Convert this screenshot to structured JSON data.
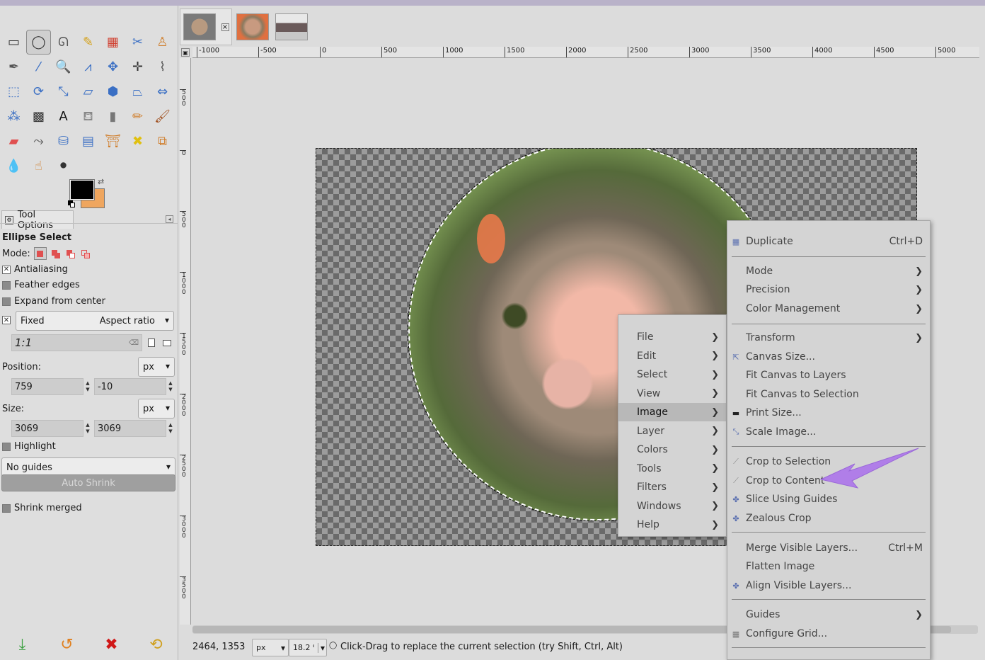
{
  "toolbox": {
    "tools": [
      {
        "name": "rect-select-icon",
        "glyph": "▭",
        "color": "#333"
      },
      {
        "name": "ellipse-select-icon",
        "glyph": "◯",
        "color": "#333",
        "active": true
      },
      {
        "name": "free-select-icon",
        "glyph": "ᘏ",
        "color": "#555"
      },
      {
        "name": "fuzzy-select-icon",
        "glyph": "✎",
        "color": "#d4a017"
      },
      {
        "name": "color-select-icon",
        "glyph": "▦",
        "color": "#d04030"
      },
      {
        "name": "scissors-select-icon",
        "glyph": "✂",
        "color": "#3a6fc4"
      },
      {
        "name": "foreground-select-icon",
        "glyph": "♙",
        "color": "#d08030"
      },
      {
        "name": "paths-icon",
        "glyph": "✒",
        "color": "#555"
      },
      {
        "name": "color-picker-icon",
        "glyph": "⁄",
        "color": "#3a6fc4"
      },
      {
        "name": "zoom-icon",
        "glyph": "🔍",
        "color": "#3a6fc4"
      },
      {
        "name": "measure-icon",
        "glyph": "⩘",
        "color": "#3a6fc4"
      },
      {
        "name": "move-icon",
        "glyph": "✥",
        "color": "#3a6fc4"
      },
      {
        "name": "alignment-icon",
        "glyph": "✛",
        "color": "#333"
      },
      {
        "name": "crop-icon",
        "glyph": "⌇",
        "color": "#555"
      },
      {
        "name": "unified-transform-icon",
        "glyph": "⬚",
        "color": "#3a6fc4"
      },
      {
        "name": "rotate-icon",
        "glyph": "⟳",
        "color": "#3a6fc4"
      },
      {
        "name": "scale-icon",
        "glyph": "⤡",
        "color": "#3a6fc4"
      },
      {
        "name": "shear-icon",
        "glyph": "▱",
        "color": "#3a6fc4"
      },
      {
        "name": "handle-transform-icon",
        "glyph": "⬢",
        "color": "#3a6fc4"
      },
      {
        "name": "perspective-icon",
        "glyph": "⏢",
        "color": "#3a6fc4"
      },
      {
        "name": "flip-icon",
        "glyph": "⇔",
        "color": "#3a6fc4"
      },
      {
        "name": "cage-transform-icon",
        "glyph": "⁂",
        "color": "#3a6fc4"
      },
      {
        "name": "warp-transform-icon",
        "glyph": "▩",
        "color": "#333"
      },
      {
        "name": "text-icon",
        "glyph": "A",
        "color": "#111"
      },
      {
        "name": "bucket-fill-icon",
        "glyph": "⛾",
        "color": "#888"
      },
      {
        "name": "gradient-icon",
        "glyph": "▮",
        "color": "#777"
      },
      {
        "name": "pencil-icon",
        "glyph": "✏",
        "color": "#d08030"
      },
      {
        "name": "paintbrush-icon",
        "glyph": "🖌",
        "color": "#a05020"
      },
      {
        "name": "eraser-icon",
        "glyph": "▰",
        "color": "#e05050"
      },
      {
        "name": "airbrush-icon",
        "glyph": "⤳",
        "color": "#555"
      },
      {
        "name": "ink-icon",
        "glyph": "⛁",
        "color": "#3a6fc4"
      },
      {
        "name": "mypaint-brush-icon",
        "glyph": "▤",
        "color": "#3a6fc4"
      },
      {
        "name": "clone-icon",
        "glyph": "⛩",
        "color": "#d08030"
      },
      {
        "name": "heal-icon",
        "glyph": "✖",
        "color": "#e0c010"
      },
      {
        "name": "perspective-clone-icon",
        "glyph": "⧉",
        "color": "#d08030"
      },
      {
        "name": "blur-sharpen-icon",
        "glyph": "💧",
        "color": "#3a6fc4"
      },
      {
        "name": "smudge-icon",
        "glyph": "☝",
        "color": "#d08030"
      },
      {
        "name": "dodge-burn-icon",
        "glyph": "⚫",
        "color": "#333"
      }
    ],
    "fg_color": "#000000",
    "bg_color": "#efa65f"
  },
  "tool_options": {
    "tab_label": "Tool Options",
    "tool_name": "Ellipse Select",
    "mode_label": "Mode:",
    "antialiasing": "Antialiasing",
    "feather_edges": "Feather edges",
    "expand_from_center": "Expand from center",
    "fixed_label": "Fixed",
    "aspect_ratio": "Aspect ratio",
    "ratio_value": "1:1",
    "position_label": "Position:",
    "position_unit": "px",
    "position_x": "759",
    "position_y": "-10",
    "size_label": "Size:",
    "size_unit": "px",
    "size_w": "3069",
    "size_h": "3069",
    "highlight": "Highlight",
    "guides": "No guides",
    "auto_shrink": "Auto Shrink",
    "shrink_merged": "Shrink merged"
  },
  "ruler": {
    "h_labels": [
      "-1000",
      "-500",
      "0",
      "500",
      "1000",
      "1500",
      "2000",
      "2500",
      "3000",
      "3500",
      "4000",
      "4500",
      "5000"
    ],
    "v_labels": [
      "500",
      "0",
      "500",
      "1000",
      "1500",
      "2000",
      "2500",
      "3000",
      "3500"
    ]
  },
  "statusbar": {
    "coords": "2464, 1353",
    "unit": "px",
    "zoom": "18.2 %",
    "message": "Click-Drag to replace the current selection (try Shift, Ctrl, Alt)"
  },
  "main_menu": {
    "items": [
      {
        "label": "File"
      },
      {
        "label": "Edit"
      },
      {
        "label": "Select"
      },
      {
        "label": "View"
      },
      {
        "label": "Image",
        "highlighted": true
      },
      {
        "label": "Layer"
      },
      {
        "label": "Colors"
      },
      {
        "label": "Tools"
      },
      {
        "label": "Filters"
      },
      {
        "label": "Windows"
      },
      {
        "label": "Help"
      }
    ]
  },
  "image_menu": {
    "duplicate": "Duplicate",
    "duplicate_shortcut": "Ctrl+D",
    "mode": "Mode",
    "precision": "Precision",
    "color_management": "Color Management",
    "transform": "Transform",
    "canvas_size": "Canvas Size...",
    "fit_canvas_layers": "Fit Canvas to Layers",
    "fit_canvas_selection": "Fit Canvas to Selection",
    "print_size": "Print Size...",
    "scale_image": "Scale Image...",
    "crop_to_selection": "Crop to Selection",
    "crop_to_content": "Crop to Content",
    "slice_using_guides": "Slice Using Guides",
    "zealous_crop": "Zealous Crop",
    "merge_visible_layers": "Merge Visible Layers...",
    "merge_shortcut": "Ctrl+M",
    "flatten_image": "Flatten Image",
    "align_visible_layers": "Align Visible Layers...",
    "guides": "Guides",
    "configure_grid": "Configure Grid..."
  },
  "annotation_color": "#b07ee8"
}
